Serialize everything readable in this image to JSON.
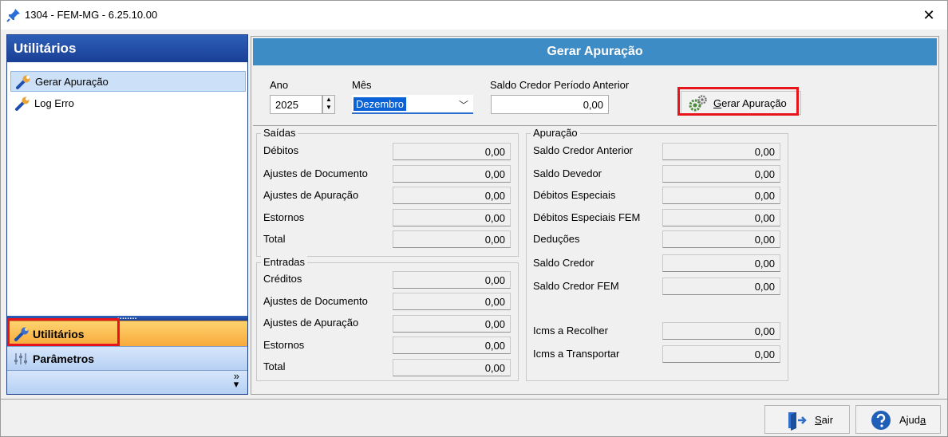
{
  "window": {
    "title": "1304 - FEM-MG - 6.25.10.00",
    "close_glyph": "✕"
  },
  "sidebar": {
    "header": "Utilitários",
    "items": [
      {
        "label": "Gerar Apuração",
        "icon": "wrench-icon",
        "selected": true
      },
      {
        "label": "Log Erro",
        "icon": "wrench-icon",
        "selected": false
      }
    ],
    "nav": [
      {
        "label": "Utilitários",
        "icon": "wrench-icon",
        "active": true
      },
      {
        "label": "Parâmetros",
        "icon": "sliders-icon",
        "active": false
      }
    ],
    "overflow_glyph": "»"
  },
  "main": {
    "header": "Gerar Apuração",
    "form": {
      "ano_label": "Ano",
      "ano_value": "2025",
      "mes_label": "Mês",
      "mes_value": "Dezembro",
      "saldo_label": "Saldo Credor Período Anterior",
      "saldo_value": "0,00",
      "gerar_button_prefix": "",
      "gerar_button_underlined": "G",
      "gerar_button_rest": "erar Apuração"
    },
    "saidas": {
      "title": "Saídas",
      "rows": [
        {
          "label": "Débitos",
          "value": "0,00"
        },
        {
          "label": "Ajustes de Documento",
          "value": "0,00"
        },
        {
          "label": "Ajustes de Apuração",
          "value": "0,00"
        },
        {
          "label": "Estornos",
          "value": "0,00"
        },
        {
          "label": "Total",
          "value": "0,00"
        }
      ]
    },
    "entradas": {
      "title": "Entradas",
      "rows": [
        {
          "label": "Créditos",
          "value": "0,00"
        },
        {
          "label": "Ajustes de Documento",
          "value": "0,00"
        },
        {
          "label": "Ajustes de Apuração",
          "value": "0,00"
        },
        {
          "label": "Estornos",
          "value": "0,00"
        },
        {
          "label": "Total",
          "value": "0,00"
        }
      ]
    },
    "apuracao": {
      "title": "Apuração",
      "rows": [
        {
          "label": "Saldo Credor Anterior",
          "value": "0,00"
        },
        {
          "label": "Saldo Devedor",
          "value": "0,00"
        },
        {
          "label": "Débitos Especiais",
          "value": "0,00"
        },
        {
          "label": "Débitos Especiais FEM",
          "value": "0,00"
        },
        {
          "label": "Deduções",
          "value": "0,00"
        },
        {
          "label": "Saldo Credor",
          "value": "0,00"
        },
        {
          "label": "Saldo Credor FEM",
          "value": "0,00"
        },
        {
          "label": "Icms a Recolher",
          "value": "0,00"
        },
        {
          "label": "Icms a Transportar",
          "value": "0,00"
        }
      ]
    }
  },
  "footer": {
    "sair_underlined": "S",
    "sair_rest": "air",
    "ajuda_prefix": "Ajud",
    "ajuda_underlined": "a"
  },
  "colors": {
    "header_blue": "#3d8cc6",
    "sidebar_blue": "#1a3f96",
    "active_orange": "#f8a93a",
    "highlight_red": "#e8141c",
    "selection_blue": "#0b62d6"
  }
}
